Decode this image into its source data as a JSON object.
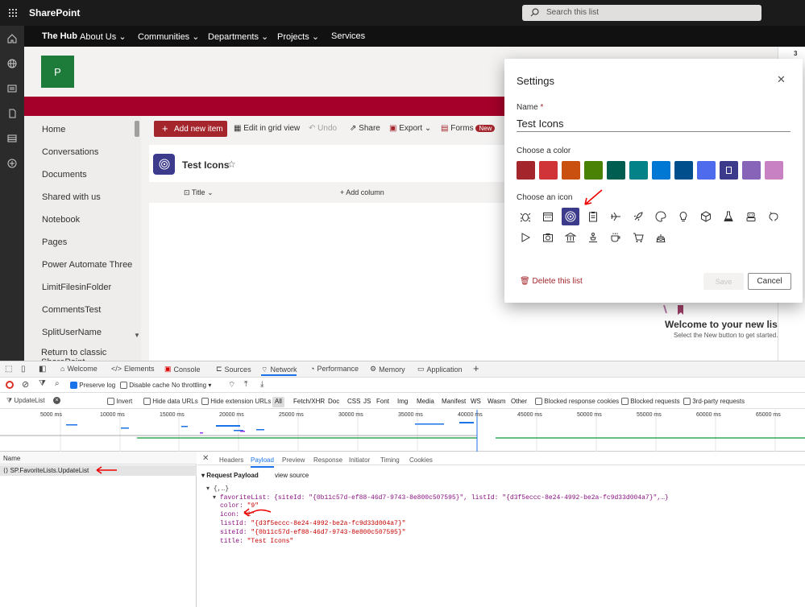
{
  "topbar": {
    "app_name": "SharePoint",
    "search_placeholder": "Search this list"
  },
  "hubnav": {
    "items": [
      "The Hub",
      "About Us",
      "Communities",
      "Departments",
      "Projects",
      "Services"
    ]
  },
  "site": {
    "logo_letter": "P"
  },
  "leftnav": {
    "items": [
      "Home",
      "Conversations",
      "Documents",
      "Shared with us",
      "Notebook",
      "Pages",
      "Power Automate Three",
      "LimitFilesinFolder",
      "CommentsTest",
      "SplitUserName"
    ],
    "footer": "Return to classic SharePoint"
  },
  "commandbar": {
    "new_item": "Add new item",
    "grid": "Edit in grid view",
    "undo": "Undo",
    "share": "Share",
    "export": "Export",
    "forms": "Forms",
    "forms_badge": "New"
  },
  "list": {
    "title": "Test Icons",
    "col_title": "Title",
    "add_column": "Add column",
    "welcome": "Welcome to your new list",
    "welcome_sub": "Select the New button to get started."
  },
  "right_strip": {
    "count": "3"
  },
  "dialog": {
    "title": "Settings",
    "name_label": "Name",
    "required_mark": "*",
    "name_value": "Test Icons",
    "color_label": "Choose a color",
    "colors": [
      "#a4262c",
      "#d13438",
      "#ca5010",
      "#498205",
      "#005e50",
      "#038387",
      "#0078d4",
      "#004e8c",
      "#4f6bed",
      "#3b3a8b",
      "#8764b8",
      "#c882c4"
    ],
    "icon_label": "Choose an icon",
    "icons": [
      "bug-icon",
      "calendar-icon",
      "target-icon",
      "clipboard-icon",
      "airplane-icon",
      "rocket-icon",
      "palette-icon",
      "lightbulb-icon",
      "cube-icon",
      "flask-icon",
      "robot-icon",
      "piggybank-icon",
      "play-icon",
      "camera-icon",
      "bank-icon",
      "award-icon",
      "coffee-icon",
      "cart-icon",
      "cake-icon"
    ],
    "delete": "Delete this list",
    "save": "Save",
    "cancel": "Cancel"
  },
  "devtools": {
    "tabs": [
      "Welcome",
      "Elements",
      "Console",
      "Sources",
      "Network",
      "Performance",
      "Memory",
      "Application"
    ],
    "preserve_log": "Preserve log",
    "disable_cache": "Disable cache",
    "throttling": "No throttling",
    "filter_value": "UpdateList",
    "invert": "Invert",
    "hide_data": "Hide data URLs",
    "hide_ext": "Hide extension URLs",
    "filters": [
      "All",
      "Fetch/XHR",
      "Doc",
      "CSS",
      "JS",
      "Font",
      "Img",
      "Media",
      "Manifest",
      "WS",
      "Wasm",
      "Other"
    ],
    "blocked_cookies": "Blocked response cookies",
    "blocked_requests": "Blocked requests",
    "third_party": "3rd-party requests",
    "timeline_ticks": [
      "5000 ms",
      "10000 ms",
      "15000 ms",
      "20000 ms",
      "25000 ms",
      "30000 ms",
      "35000 ms",
      "40000 ms",
      "45000 ms",
      "50000 ms",
      "55000 ms",
      "60000 ms",
      "65000 ms"
    ],
    "name_header": "Name",
    "request_name": "SP.FavoriteLists.UpdateList",
    "panel_tabs": [
      "Headers",
      "Payload",
      "Preview",
      "Response",
      "Initiator",
      "Timing",
      "Cookies"
    ],
    "payload_section": "Request Payload",
    "view_source": "view source",
    "root": "{,…}",
    "favoriteList_line": "favoriteList: {siteId: \"{0b11c57d-ef88-46d7-9743-8e800c507595}\", listId: \"{d3f5eccc-8e24-4992-be2a-fc9d33d004a7}\",…}",
    "color_key": "color:",
    "color_val": "\"9\"",
    "icon_key": "icon:",
    "icon_val": "\"2\"",
    "listId_key": "listId:",
    "listId_val": "\"{d3f5eccc-8e24-4992-be2a-fc9d33d004a7}\"",
    "siteId_key": "siteId:",
    "siteId_val": "\"{0b11c57d-ef88-46d7-9743-8e800c507595}\"",
    "title_key": "title:",
    "title_val": "\"Test Icons\""
  }
}
